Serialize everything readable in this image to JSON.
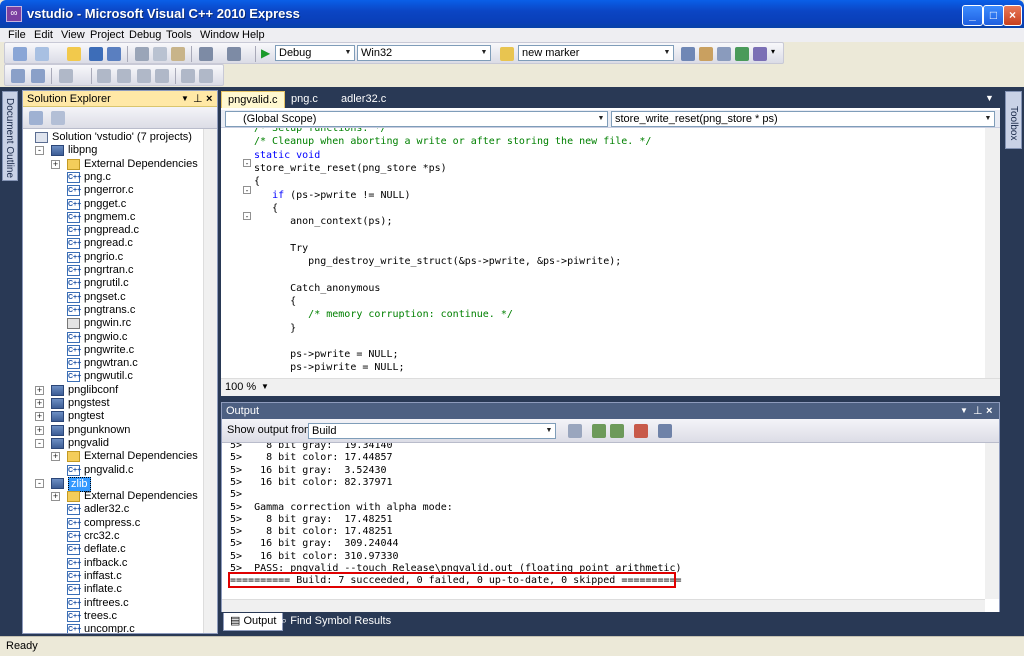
{
  "window": {
    "title": "vstudio - Microsoft Visual C++ 2010 Express",
    "icon": "vs-app-icon"
  },
  "menu": [
    "File",
    "Edit",
    "View",
    "Project",
    "Debug",
    "Tools",
    "Window",
    "Help"
  ],
  "toolbar": {
    "config": "Debug",
    "platform": "Win32",
    "marker": "new marker"
  },
  "side_strips": {
    "left": "Document Outline",
    "right": "Toolbox"
  },
  "solution_explorer": {
    "title": "Solution Explorer",
    "items": [
      {
        "label": "Solution 'vstudio' (7 projects)",
        "type": "sol",
        "depth": 0
      },
      {
        "label": "libpng",
        "type": "proj",
        "depth": 1,
        "exp": "-"
      },
      {
        "label": "External Dependencies",
        "type": "fold",
        "depth": 2,
        "exp": "+"
      },
      {
        "label": "png.c",
        "type": "cpp",
        "depth": 2
      },
      {
        "label": "pngerror.c",
        "type": "cpp",
        "depth": 2
      },
      {
        "label": "pngget.c",
        "type": "cpp",
        "depth": 2
      },
      {
        "label": "pngmem.c",
        "type": "cpp",
        "depth": 2
      },
      {
        "label": "pngpread.c",
        "type": "cpp",
        "depth": 2
      },
      {
        "label": "pngread.c",
        "type": "cpp",
        "depth": 2
      },
      {
        "label": "pngrio.c",
        "type": "cpp",
        "depth": 2
      },
      {
        "label": "pngrtran.c",
        "type": "cpp",
        "depth": 2
      },
      {
        "label": "pngrutil.c",
        "type": "cpp",
        "depth": 2
      },
      {
        "label": "pngset.c",
        "type": "cpp",
        "depth": 2
      },
      {
        "label": "pngtrans.c",
        "type": "cpp",
        "depth": 2
      },
      {
        "label": "pngwin.rc",
        "type": "rc",
        "depth": 2
      },
      {
        "label": "pngwio.c",
        "type": "cpp",
        "depth": 2
      },
      {
        "label": "pngwrite.c",
        "type": "cpp",
        "depth": 2
      },
      {
        "label": "pngwtran.c",
        "type": "cpp",
        "depth": 2
      },
      {
        "label": "pngwutil.c",
        "type": "cpp",
        "depth": 2
      },
      {
        "label": "pnglibconf",
        "type": "proj",
        "depth": 1,
        "exp": "+"
      },
      {
        "label": "pngstest",
        "type": "proj",
        "depth": 1,
        "exp": "+"
      },
      {
        "label": "pngtest",
        "type": "proj",
        "depth": 1,
        "exp": "+"
      },
      {
        "label": "pngunknown",
        "type": "proj",
        "depth": 1,
        "exp": "+"
      },
      {
        "label": "pngvalid",
        "type": "proj",
        "depth": 1,
        "exp": "-"
      },
      {
        "label": "External Dependencies",
        "type": "fold",
        "depth": 2,
        "exp": "+"
      },
      {
        "label": "pngvalid.c",
        "type": "cpp",
        "depth": 2
      },
      {
        "label": "zlib",
        "type": "proj",
        "depth": 1,
        "exp": "-",
        "selected": true
      },
      {
        "label": "External Dependencies",
        "type": "fold",
        "depth": 2,
        "exp": "+"
      },
      {
        "label": "adler32.c",
        "type": "cpp",
        "depth": 2
      },
      {
        "label": "compress.c",
        "type": "cpp",
        "depth": 2
      },
      {
        "label": "crc32.c",
        "type": "cpp",
        "depth": 2
      },
      {
        "label": "deflate.c",
        "type": "cpp",
        "depth": 2
      },
      {
        "label": "infback.c",
        "type": "cpp",
        "depth": 2
      },
      {
        "label": "inffast.c",
        "type": "cpp",
        "depth": 2
      },
      {
        "label": "inflate.c",
        "type": "cpp",
        "depth": 2
      },
      {
        "label": "inftrees.c",
        "type": "cpp",
        "depth": 2
      },
      {
        "label": "trees.c",
        "type": "cpp",
        "depth": 2
      },
      {
        "label": "uncompr.c",
        "type": "cpp",
        "depth": 2
      }
    ]
  },
  "editor": {
    "tabs": [
      "pngvalid.c",
      "png.c",
      "adler32.c"
    ],
    "active_tab": 0,
    "scope": "(Global Scope)",
    "function": "store_write_reset(png_store * ps)",
    "zoom": "100 %",
    "lines": [
      {
        "t": "/* Setup functions. */",
        "c": "cm"
      },
      {
        "t": "/* Cleanup when aborting a write or after storing the new file. */",
        "c": "cm"
      },
      {
        "t": "static void",
        "c": "kw"
      },
      {
        "t": "store_write_reset(png_store *ps)",
        "c": ""
      },
      {
        "t": "{",
        "c": ""
      },
      {
        "t": "   if (ps->pwrite != NULL)",
        "c": "if"
      },
      {
        "t": "   {",
        "c": ""
      },
      {
        "t": "      anon_context(ps);",
        "c": ""
      },
      {
        "t": "",
        "c": ""
      },
      {
        "t": "      Try",
        "c": ""
      },
      {
        "t": "         png_destroy_write_struct(&ps->pwrite, &ps->piwrite);",
        "c": ""
      },
      {
        "t": "",
        "c": ""
      },
      {
        "t": "      Catch_anonymous",
        "c": ""
      },
      {
        "t": "      {",
        "c": ""
      },
      {
        "t": "         /* memory corruption: continue. */",
        "c": "cm"
      },
      {
        "t": "      }",
        "c": ""
      },
      {
        "t": "",
        "c": ""
      },
      {
        "t": "      ps->pwrite = NULL;",
        "c": ""
      },
      {
        "t": "      ps->piwrite = NULL;",
        "c": ""
      }
    ]
  },
  "output": {
    "title": "Output",
    "show_from_label": "Show output from:",
    "source": "Build",
    "lines": [
      "5>    8 bit gray:  19.34140",
      "5>    8 bit color: 17.44857",
      "5>   16 bit gray:  3.52430",
      "5>   16 bit color: 82.37971",
      "5>",
      "5>  Gamma correction with alpha mode:",
      "5>    8 bit gray:  17.48251",
      "5>    8 bit color: 17.48251",
      "5>   16 bit gray:  309.24044",
      "5>   16 bit color: 310.97330",
      "5>  PASS: pngvalid --touch Release\\pngvalid.out (floating point arithmetic)",
      "========== Build: 7 succeeded, 0 failed, 0 up-to-date, 0 skipped =========="
    ]
  },
  "bottom_tabs": [
    "Output",
    "Find Symbol Results"
  ],
  "status": "Ready"
}
